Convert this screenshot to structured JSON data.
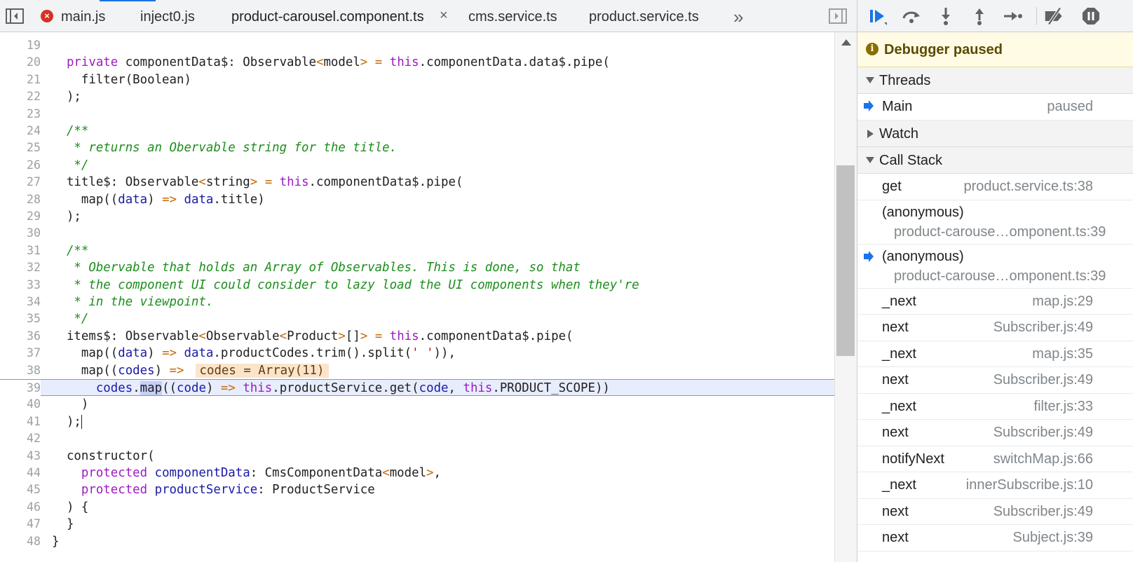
{
  "editor": {
    "tabs": [
      {
        "label": "main.js",
        "error": true
      },
      {
        "label": "inject0.js"
      },
      {
        "label": "product-carousel.component.ts",
        "active": true
      },
      {
        "label": "cms.service.ts"
      },
      {
        "label": "product.service.ts"
      }
    ],
    "overflow_glyph": "»",
    "close_glyph": "×",
    "error_glyph": "×",
    "current_line": 39,
    "lines": [
      {
        "n": "19",
        "html": ""
      },
      {
        "n": "20",
        "html": "  <span class=\"kw\">private</span> componentData$: Observable<span class=\"ar\">&lt;</span>model<span class=\"ar\">&gt;</span> <span class=\"ar\">=</span> <span class=\"kw\">this</span>.componentData.data$.pipe("
      },
      {
        "n": "21",
        "html": "    filter(Boolean)"
      },
      {
        "n": "22",
        "html": "  );"
      },
      {
        "n": "23",
        "html": ""
      },
      {
        "n": "24",
        "html": "  <span class=\"cm\">/**</span>"
      },
      {
        "n": "25",
        "html": "<span class=\"cm\">   * returns an Obervable string for the title.</span>"
      },
      {
        "n": "26",
        "html": "<span class=\"cm\">   */</span>"
      },
      {
        "n": "27",
        "html": "  title$: Observable<span class=\"ar\">&lt;</span>string<span class=\"ar\">&gt;</span> <span class=\"ar\">=</span> <span class=\"kw\">this</span>.componentData$.pipe("
      },
      {
        "n": "28",
        "html": "    map((<span class=\"k2\">data</span>) <span class=\"ar\">=&gt;</span> <span class=\"k2\">data</span>.title)"
      },
      {
        "n": "29",
        "html": "  );"
      },
      {
        "n": "30",
        "html": ""
      },
      {
        "n": "31",
        "html": "  <span class=\"cm\">/**</span>"
      },
      {
        "n": "32",
        "html": "<span class=\"cm\">   * Obervable that holds an Array of Observables. This is done, so that</span>"
      },
      {
        "n": "33",
        "html": "<span class=\"cm\">   * the component UI could consider to lazy load the UI components when they're</span>"
      },
      {
        "n": "34",
        "html": "<span class=\"cm\">   * in the viewpoint.</span>"
      },
      {
        "n": "35",
        "html": "<span class=\"cm\">   */</span>"
      },
      {
        "n": "36",
        "html": "  items$: Observable<span class=\"ar\">&lt;</span>Observable<span class=\"ar\">&lt;</span>Product<span class=\"ar\">&gt;</span>[]<span class=\"ar\">&gt;</span> <span class=\"ar\">=</span> <span class=\"kw\">this</span>.componentData$.pipe("
      },
      {
        "n": "37",
        "html": "    map((<span class=\"k2\">data</span>) <span class=\"ar\">=&gt;</span> <span class=\"k2\">data</span>.productCodes.trim().split(<span class=\"str\">' '</span>)),"
      },
      {
        "n": "38",
        "html": "    map((<span class=\"k2\">codes</span>) <span class=\"ar\">=&gt;</span><span class=\"inline-val\">codes = Array(11)</span>"
      },
      {
        "n": "39",
        "html": "      <span class=\"k2\">codes</span>.<span class=\"hl-word\">map</span>((<span class=\"k2\">code</span>) <span class=\"ar\">=&gt;</span> <span class=\"kw\">this</span>.productService.get(<span class=\"k2\">code</span>, <span class=\"kw\">this</span>.PRODUCT_SCOPE))"
      },
      {
        "n": "40",
        "html": "    )"
      },
      {
        "n": "41",
        "html": "  );<span class=\"caret\"></span>"
      },
      {
        "n": "42",
        "html": ""
      },
      {
        "n": "43",
        "html": "  constructor("
      },
      {
        "n": "44",
        "html": "    <span class=\"kw\">protected</span> <span class=\"k2\">componentData</span>: CmsComponentData<span class=\"ar\">&lt;</span>model<span class=\"ar\">&gt;</span>,"
      },
      {
        "n": "45",
        "html": "    <span class=\"kw\">protected</span> <span class=\"k2\">productService</span>: ProductService"
      },
      {
        "n": "46",
        "html": "  ) {"
      },
      {
        "n": "47",
        "html": "  }"
      },
      {
        "n": "48",
        "html": "}"
      }
    ]
  },
  "debugger": {
    "status": "Debugger paused",
    "status_icon": "info-icon",
    "sections": {
      "threads": "Threads",
      "watch": "Watch",
      "call_stack": "Call Stack"
    },
    "thread": {
      "name": "Main",
      "state": "paused"
    },
    "call_stack": [
      {
        "fn": "get",
        "loc": "product.service.ts:38"
      },
      {
        "fn": "(anonymous)",
        "loc2": "product-carouse…omponent.ts:39"
      },
      {
        "fn": "(anonymous)",
        "loc2": "product-carouse…omponent.ts:39",
        "current": true
      },
      {
        "fn": "_next",
        "loc": "map.js:29"
      },
      {
        "fn": "next",
        "loc": "Subscriber.js:49"
      },
      {
        "fn": "_next",
        "loc": "map.js:35"
      },
      {
        "fn": "next",
        "loc": "Subscriber.js:49"
      },
      {
        "fn": "_next",
        "loc": "filter.js:33"
      },
      {
        "fn": "next",
        "loc": "Subscriber.js:49"
      },
      {
        "fn": "notifyNext",
        "loc": "switchMap.js:66"
      },
      {
        "fn": "_next",
        "loc": "innerSubscribe.js:10"
      },
      {
        "fn": "next",
        "loc": "Subscriber.js:49"
      },
      {
        "fn": "next",
        "loc": "Subject.js:39"
      }
    ],
    "colors": {
      "accent": "#1a73e8",
      "paused_bg": "#fffbe5"
    }
  }
}
